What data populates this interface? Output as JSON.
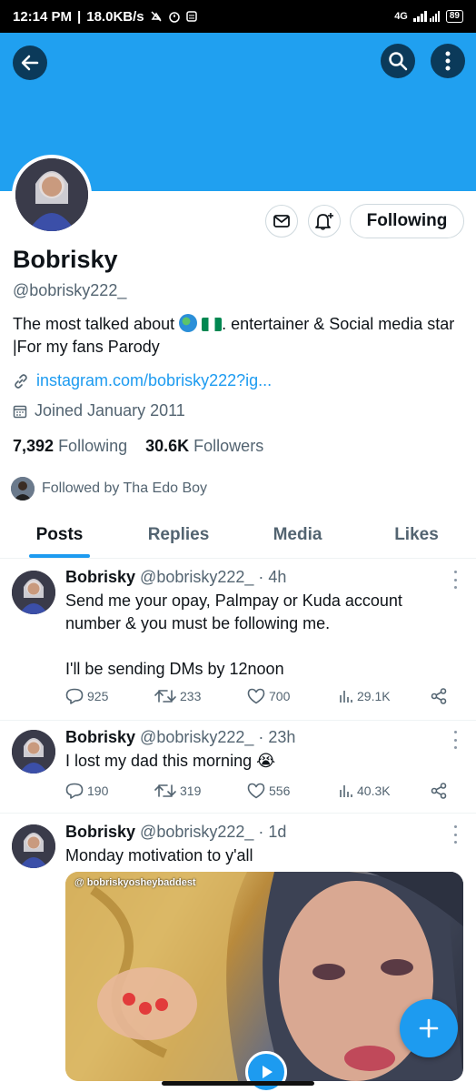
{
  "status_bar": {
    "time": "12:14 PM",
    "speed": "18.0KB/s",
    "network": "4G",
    "battery": "89"
  },
  "header": {
    "back": "back-arrow-icon",
    "search": "search-icon",
    "more": "more-vertical-icon",
    "banner_color": "#20a0f0"
  },
  "profile": {
    "name": "Bobrisky",
    "handle": "@bobrisky222_",
    "bio_part1": "The most talked about",
    "bio_part2": ". entertainer & Social media star |For my fans Parody",
    "link": "instagram.com/bobrisky222?ig...",
    "joined": "Joined January 2011",
    "following_count": "7,392",
    "following_label": "Following",
    "followers_count": "30.6K",
    "followers_label": "Followers",
    "followed_by": "Followed by Tha Edo Boy",
    "follow_button": "Following"
  },
  "tabs": [
    {
      "label": "Posts",
      "active": true
    },
    {
      "label": "Replies",
      "active": false
    },
    {
      "label": "Media",
      "active": false
    },
    {
      "label": "Likes",
      "active": false
    }
  ],
  "tweets": [
    {
      "name": "Bobrisky",
      "handle": "@bobrisky222_",
      "time": "· 4h",
      "text": "Send me your opay, Palmpay or Kuda account number & you must be following me.\n\nI'll be sending DMs by 12noon",
      "replies": "925",
      "retweets": "233",
      "likes": "700",
      "views": "29.1K"
    },
    {
      "name": "Bobrisky",
      "handle": "@bobrisky222_",
      "time": "· 23h",
      "text": "I lost my dad this morning 😭",
      "replies": "190",
      "retweets": "319",
      "likes": "556",
      "views": "40.3K"
    },
    {
      "name": "Bobrisky",
      "handle": "@bobrisky222_",
      "time": "· 1d",
      "text": "Monday motivation to y'all",
      "media_caption": "@ bobriskyosheybaddest"
    }
  ],
  "accent_color": "#1d9bf0"
}
